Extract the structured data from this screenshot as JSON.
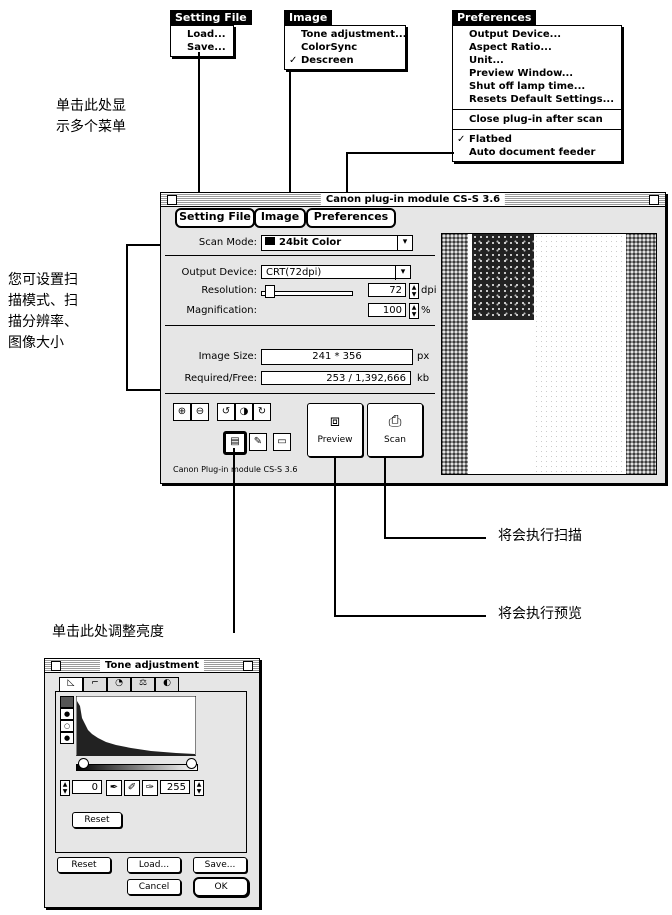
{
  "menus": {
    "setting_file": {
      "title": "Setting File",
      "items": [
        "Load...",
        "Save..."
      ]
    },
    "image": {
      "title": "Image",
      "items": [
        {
          "label": "Tone adjustment...",
          "checked": false
        },
        {
          "label": "ColorSync",
          "checked": false
        },
        {
          "label": "Descreen",
          "checked": true
        }
      ]
    },
    "preferences": {
      "title": "Preferences",
      "items_group1": [
        "Output Device...",
        "Aspect Ratio...",
        "Unit...",
        "Preview Window...",
        "Shut off lamp time...",
        "Resets Default Settings..."
      ],
      "items_group2": [
        "Close plug-in after scan"
      ],
      "flatbed": "Flatbed",
      "flatbed_checked": true,
      "feeder": "Auto document feeder"
    }
  },
  "notes": {
    "multi_menu_1": "单击此处显",
    "multi_menu_2": "示多个菜单",
    "settings_1": "您可设置扫",
    "settings_2": "描模式、扫",
    "settings_3": "描分辨率、",
    "settings_4": "图像大小",
    "scan": "将会执行扫描",
    "preview": "将会执行预览",
    "brightness": "单击此处调整亮度"
  },
  "main_window": {
    "title": "Canon plug-in module CS-S 3.6",
    "tabs": [
      "Setting File",
      "Image",
      "Preferences"
    ],
    "scan_mode_label": "Scan Mode:",
    "scan_mode_value": "24bit Color",
    "output_device_label": "Output Device:",
    "output_device_value": "CRT(72dpi)",
    "resolution_label": "Resolution:",
    "resolution_value": "72",
    "resolution_unit": "dpi",
    "magnification_label": "Magnification:",
    "magnification_value": "100",
    "magnification_unit": "%",
    "image_size_label": "Image Size:",
    "image_size_value": "241 * 356",
    "image_size_unit": "px",
    "required_free_label": "Required/Free:",
    "required_free_value": "253 / 1,392,666",
    "required_free_unit": "kb",
    "preview_label": "Preview",
    "scan_label": "Scan",
    "footer": "Canon Plug-in module CS-S 3.6"
  },
  "tone_window": {
    "title": "Tone adjustment",
    "low_value": "0",
    "high_value": "255",
    "inner_reset": "Reset",
    "reset": "Reset",
    "load": "Load...",
    "save": "Save...",
    "cancel": "Cancel",
    "ok": "OK"
  }
}
